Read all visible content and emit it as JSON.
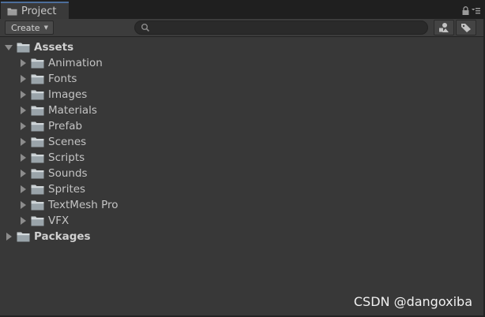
{
  "tab": {
    "title": "Project",
    "icon": "folder-icon"
  },
  "tab_controls": {
    "lock_icon": "lock-icon",
    "menu_icon": "menu-icon"
  },
  "toolbar": {
    "create_label": "Create",
    "search_value": "",
    "search_placeholder": "",
    "search_icon": "search-icon",
    "filter_by_type_icon": "filter-by-type-icon",
    "filter_by_label_icon": "filter-by-label-icon"
  },
  "tree": {
    "assets": {
      "label": "Assets",
      "expanded": true,
      "children": [
        {
          "label": "Animation"
        },
        {
          "label": "Fonts"
        },
        {
          "label": "Images"
        },
        {
          "label": "Materials"
        },
        {
          "label": "Prefab"
        },
        {
          "label": "Scenes"
        },
        {
          "label": "Scripts"
        },
        {
          "label": "Sounds"
        },
        {
          "label": "Sprites"
        },
        {
          "label": "TextMesh Pro"
        },
        {
          "label": "VFX"
        }
      ]
    },
    "packages": {
      "label": "Packages",
      "expanded": false
    }
  },
  "watermark": "CSDN @dangoxiba",
  "colors": {
    "background": "#383838",
    "tabstrip": "#1f1f1f",
    "tab_accent": "#4d6e9a",
    "text": "#c4c4c4",
    "folder": "#9aa4aa"
  }
}
